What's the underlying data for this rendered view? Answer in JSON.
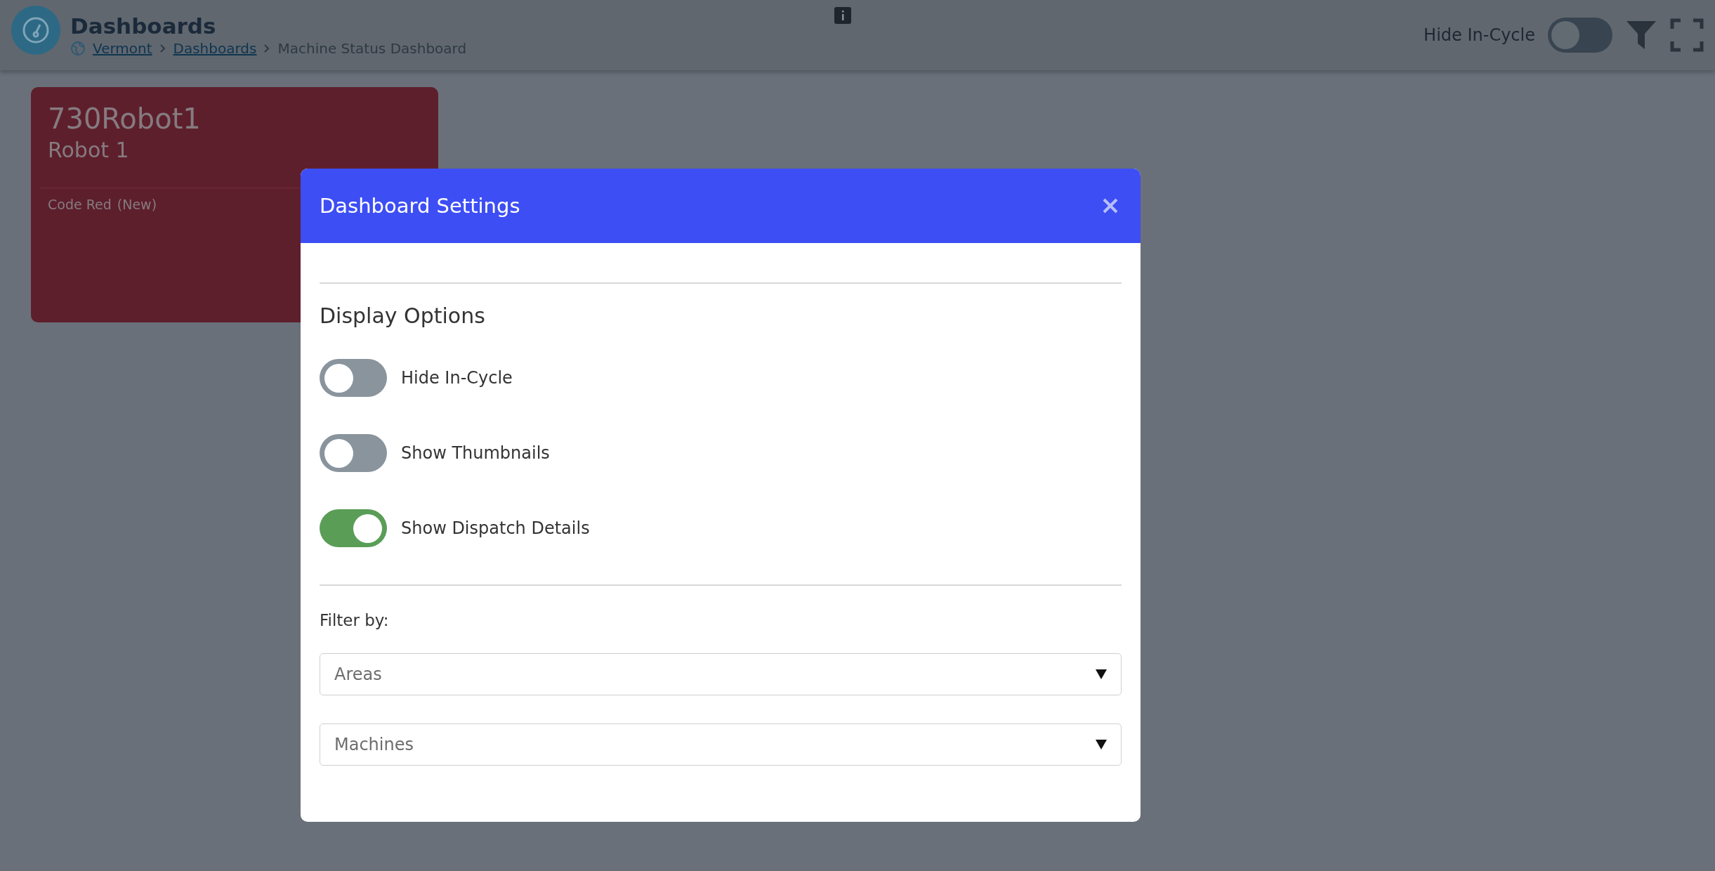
{
  "header": {
    "title": "Dashboards",
    "breadcrumbs": [
      {
        "label": "Vermont",
        "kind": "link"
      },
      {
        "label": "Dashboards",
        "kind": "link"
      },
      {
        "label": "Machine Status Dashboard",
        "kind": "current"
      }
    ],
    "hide_in_cycle": {
      "label": "Hide In-Cycle",
      "on": false
    }
  },
  "cards": [
    {
      "title": "730Robot1",
      "subtitle": "Robot 1",
      "status": "Code Red",
      "tag": "(New)"
    }
  ],
  "dialog": {
    "title": "Dashboard Settings",
    "section": "Display Options",
    "toggles": [
      {
        "label": "Hide In-Cycle",
        "on": false
      },
      {
        "label": "Show Thumbnails",
        "on": false
      },
      {
        "label": "Show Dispatch Details",
        "on": true
      }
    ],
    "filter_label": "Filter by:",
    "selects": [
      {
        "placeholder": "Areas"
      },
      {
        "placeholder": "Machines"
      }
    ]
  }
}
